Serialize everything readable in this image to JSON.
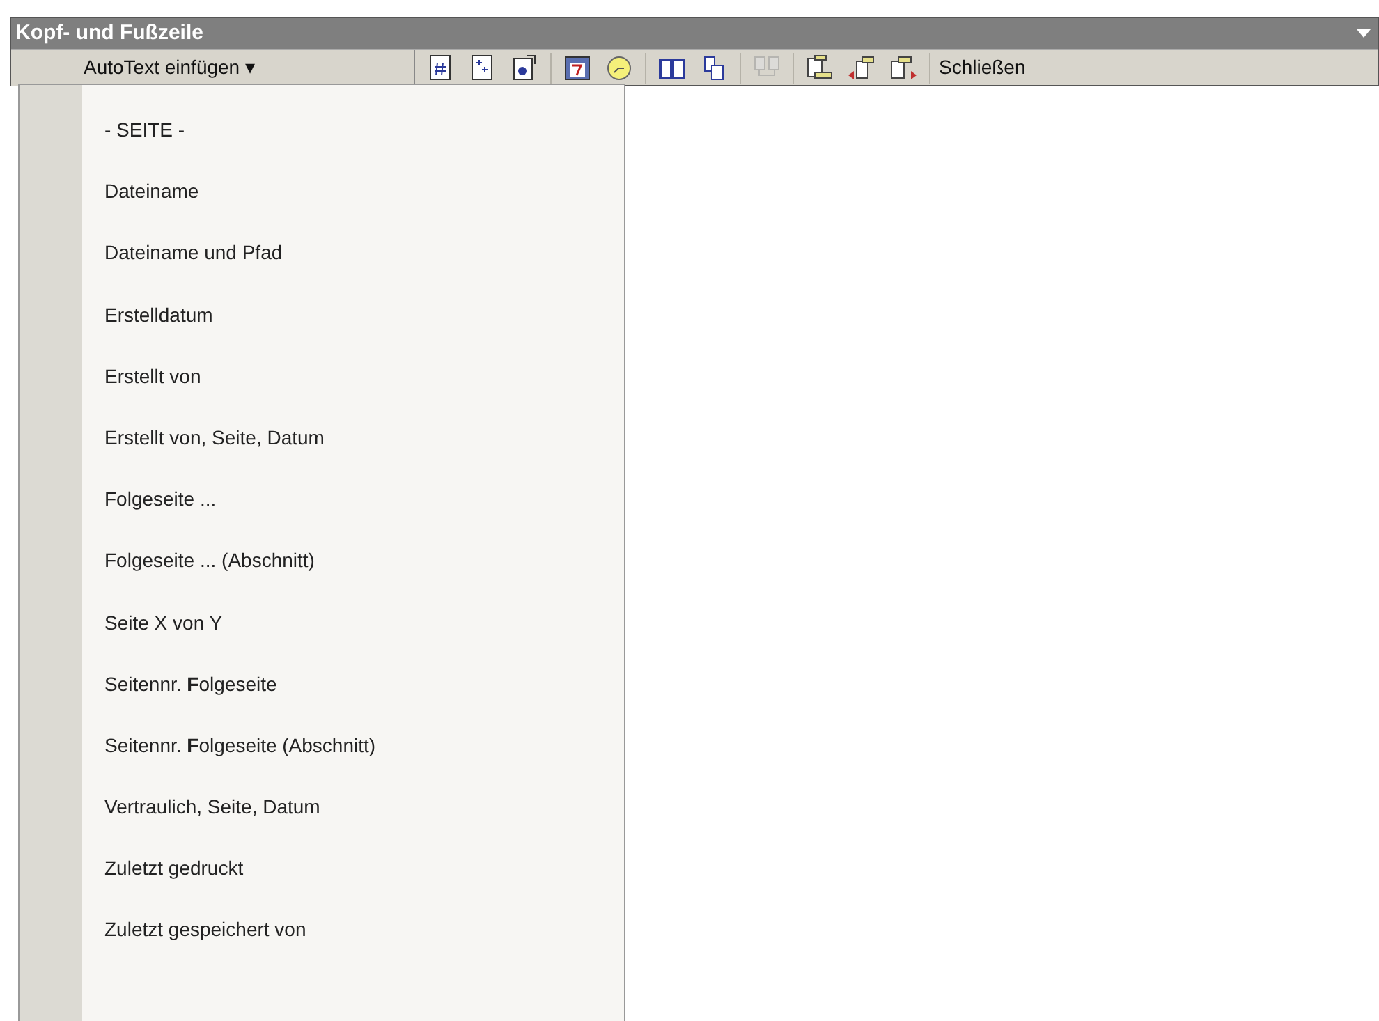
{
  "window": {
    "title": "Kopf- und Fußzeile"
  },
  "toolbar": {
    "autotext_button": "AutoText einfügen ▾",
    "groups": [
      [
        {
          "kind": "page-number",
          "disabled": false
        },
        {
          "kind": "page-count",
          "disabled": false
        },
        {
          "kind": "format-page",
          "disabled": false
        }
      ],
      [
        {
          "kind": "date",
          "disabled": false
        },
        {
          "kind": "time",
          "disabled": false
        }
      ],
      [
        {
          "kind": "book",
          "disabled": false
        },
        {
          "kind": "pages",
          "disabled": false
        }
      ],
      [
        {
          "kind": "link",
          "disabled": true
        }
      ],
      [
        {
          "kind": "switch",
          "disabled": false
        },
        {
          "kind": "previous",
          "disabled": false
        },
        {
          "kind": "next",
          "disabled": false
        }
      ]
    ],
    "close_button": "Schließen"
  },
  "menu": {
    "items": [
      {
        "label": "- SEITE -"
      },
      {
        "label": "Dateiname"
      },
      {
        "label": "Dateiname und Pfad"
      },
      {
        "label": "Erstelldatum"
      },
      {
        "label": "Erstellt von"
      },
      {
        "label": "Erstellt von, Seite, Datum"
      },
      {
        "label": "Folgeseite ..."
      },
      {
        "label": "Folgeseite ... (Abschnitt)"
      },
      {
        "label": "Seite X von Y"
      },
      {
        "label": "Seitennr. **F**olgeseite"
      },
      {
        "label": "Seitennr. **F**olgeseite (Abschnitt)"
      },
      {
        "label": "Vertraulich, Seite, Datum"
      },
      {
        "label": "Zuletzt gedruckt"
      },
      {
        "label": "Zuletzt gespeichert von"
      }
    ]
  }
}
